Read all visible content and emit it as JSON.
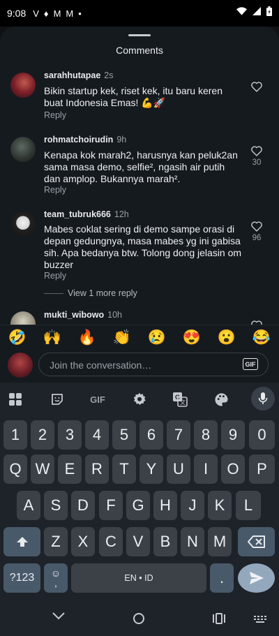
{
  "status_bar": {
    "time": "9:08",
    "notification_icons": [
      "V",
      "♦",
      "M",
      "M",
      "•"
    ]
  },
  "sheet": {
    "title": "Comments"
  },
  "comments": [
    {
      "username": "sarahhutapae",
      "time": "2s",
      "text": "Bikin startup kek, riset kek, itu baru keren buat Indonesia Emas! 💪🚀",
      "reply_label": "Reply",
      "likes": ""
    },
    {
      "username": "rohmatchoirudin",
      "time": "9h",
      "text": "Kenapa kok marah2, harusnya kan peluk2an sama masa demo, selfie², ngasih air putih dan amplop. Bukannya marah².",
      "reply_label": "Reply",
      "likes": "30"
    },
    {
      "username": "team_tubruk666",
      "time": "12h",
      "text": "Mabes coklat sering di demo sampe orasi di depan gedungnya, masa mabes yg ini gabisa sih. Apa bedanya btw. Tolong dong jelasin om buzzer",
      "reply_label": "Reply",
      "likes": "96"
    },
    {
      "username": "mukti_wibowo",
      "time": "10h",
      "text": "",
      "reply_label": "",
      "likes": ""
    }
  ],
  "view_more_label": "View 1 more reply",
  "emojis": [
    "🤣",
    "🙌",
    "🔥",
    "👏",
    "😢",
    "😍",
    "😮",
    "😂"
  ],
  "input": {
    "placeholder": "Join the conversation…",
    "gif_label": "GIF"
  },
  "keyboard": {
    "toolbar": {
      "gif_label": "GIF"
    },
    "numbers": [
      "1",
      "2",
      "3",
      "4",
      "5",
      "6",
      "7",
      "8",
      "9",
      "0"
    ],
    "row1": [
      "Q",
      "W",
      "E",
      "R",
      "T",
      "Y",
      "U",
      "I",
      "O",
      "P"
    ],
    "row2": [
      "A",
      "S",
      "D",
      "F",
      "G",
      "H",
      "J",
      "K",
      "L"
    ],
    "row3": [
      "Z",
      "X",
      "C",
      "V",
      "B",
      "N",
      "M"
    ],
    "symbols_key": "?123",
    "emoji_key_top": "☺",
    "emoji_key_bottom": ",",
    "space_label": "EN • ID",
    "period_key": "."
  }
}
